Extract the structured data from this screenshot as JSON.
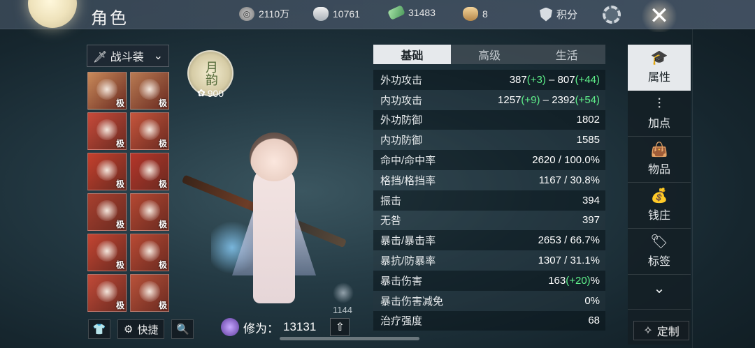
{
  "header": {
    "title": "角色",
    "resources": [
      {
        "icon": "coin-icon",
        "value": "2110万"
      },
      {
        "icon": "silver-ingot-icon",
        "value": "10761"
      },
      {
        "icon": "jade-icon",
        "value": "31483"
      },
      {
        "icon": "gold-ingot-icon",
        "value": "8"
      }
    ],
    "points_label": "积分"
  },
  "left_panel": {
    "outfit_label": "战斗装",
    "equipment": [
      {
        "slot": "accessory-chain",
        "tier": "极",
        "color": "#c98a5a"
      },
      {
        "slot": "blade",
        "tier": "极",
        "color": "#b87a52"
      },
      {
        "slot": "portrait",
        "tier": "极",
        "color": "#c74a3a"
      },
      {
        "slot": "white-flower",
        "tier": "极",
        "color": "#c6553c"
      },
      {
        "slot": "robe",
        "tier": "极",
        "color": "#c5402d"
      },
      {
        "slot": "sleeve",
        "tier": "极",
        "color": "#b5352a"
      },
      {
        "slot": "belt",
        "tier": "极",
        "color": "#a8402f"
      },
      {
        "slot": "bracelet",
        "tier": "极",
        "color": "#b54832"
      },
      {
        "slot": "skirt",
        "tier": "极",
        "color": "#c44532"
      },
      {
        "slot": "ring",
        "tier": "极",
        "color": "#b94a34"
      },
      {
        "slot": "boots",
        "tier": "极",
        "color": "#c24a38"
      },
      {
        "slot": "pendant",
        "tier": "极",
        "color": "#b9523a"
      }
    ],
    "quick_label": "快捷"
  },
  "badge": {
    "text": "月韵",
    "score": "900"
  },
  "character": {
    "power": "1144"
  },
  "cultivation": {
    "label": "修为：",
    "value": "13131"
  },
  "stats": {
    "tabs": [
      "基础",
      "高级",
      "生活"
    ],
    "active_tab": 0,
    "rows": [
      {
        "name": "外功攻击",
        "parts": [
          [
            "387",
            ""
          ],
          [
            "(+3)",
            "g"
          ],
          [
            " – 807",
            ""
          ],
          [
            "(+44)",
            "g"
          ]
        ]
      },
      {
        "name": "内功攻击",
        "parts": [
          [
            "1257",
            ""
          ],
          [
            "(+9)",
            "g"
          ],
          [
            " – 2392",
            ""
          ],
          [
            "(+54)",
            "g"
          ]
        ]
      },
      {
        "name": "外功防御",
        "parts": [
          [
            "1802",
            ""
          ]
        ]
      },
      {
        "name": "内功防御",
        "parts": [
          [
            "1585",
            ""
          ]
        ]
      },
      {
        "name": "命中/命中率",
        "parts": [
          [
            "2620 / 100.0%",
            ""
          ]
        ]
      },
      {
        "name": "格挡/格挡率",
        "parts": [
          [
            "1167 / 30.8%",
            ""
          ]
        ]
      },
      {
        "name": "振击",
        "parts": [
          [
            "394",
            ""
          ]
        ]
      },
      {
        "name": "无咎",
        "parts": [
          [
            "397",
            ""
          ]
        ]
      },
      {
        "name": "暴击/暴击率",
        "parts": [
          [
            "2653 / 66.7%",
            ""
          ]
        ]
      },
      {
        "name": "暴抗/防暴率",
        "parts": [
          [
            "1307 / 31.1%",
            ""
          ]
        ]
      },
      {
        "name": "暴击伤害",
        "parts": [
          [
            "163",
            ""
          ],
          [
            "(+20)",
            "g"
          ],
          [
            "%",
            ""
          ]
        ]
      },
      {
        "name": "暴击伤害减免",
        "parts": [
          [
            "0%",
            ""
          ]
        ]
      },
      {
        "name": "治疗强度",
        "parts": [
          [
            "68",
            ""
          ]
        ]
      }
    ]
  },
  "right_nav": {
    "items": [
      {
        "label": "属性",
        "icon": "mortarboard-icon",
        "glyph": "🎓",
        "active": true
      },
      {
        "label": "加点",
        "icon": "sliders-icon",
        "glyph": "⫶",
        "active": false
      },
      {
        "label": "物品",
        "icon": "bag-icon",
        "glyph": "👜",
        "active": false
      },
      {
        "label": "钱庄",
        "icon": "money-bag-icon",
        "glyph": "💰",
        "active": false
      },
      {
        "label": "标签",
        "icon": "tag-icon",
        "glyph": "🏷",
        "active": false
      }
    ],
    "custom_label": "定制"
  }
}
